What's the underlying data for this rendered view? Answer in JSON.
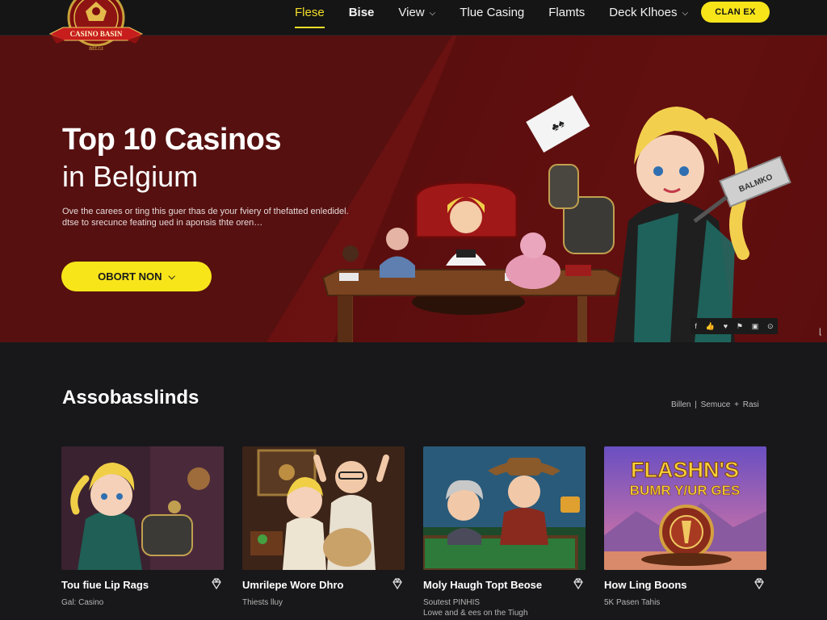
{
  "brand": {
    "logo_text": "CASINO BASIN",
    "logo_sub": "BELGI"
  },
  "nav": {
    "items": [
      {
        "label": "Flese",
        "active": true
      },
      {
        "label": "Bise",
        "bold": true
      },
      {
        "label": "View",
        "dropdown": true
      },
      {
        "label": "Tlue Casing"
      },
      {
        "label": "Flamts"
      },
      {
        "label": "Deck Klhoes",
        "dropdown": true
      }
    ],
    "cta": "CLAN EX"
  },
  "hero": {
    "title": "Top 10 Casinos",
    "subtitle": "in Belgium",
    "description_line1": "Ove the carees or ting this guer thas de your fviery of thefatted enledidel.",
    "description_line2": "dtse to srecunce feating ued in aponsis thte oren…",
    "button": "OBORT NON",
    "banner_sign": "BALMKO"
  },
  "section": {
    "title": "Assobasslinds",
    "link_left": "Billen",
    "separator": "|",
    "link_right": "Semuce + Rasi"
  },
  "cards": [
    {
      "title": "Tou fiue Lip Rags",
      "subtitle": "Gal: Casino",
      "subtitle2": ""
    },
    {
      "title": "Umrilepe Wore Dhro",
      "subtitle": "Thiests lluy",
      "subtitle2": ""
    },
    {
      "title": "Moly Haugh Topt Beose",
      "subtitle": "Soutest PINHIS",
      "subtitle2": "Lowe and & ees on the Tiugh"
    },
    {
      "title": "How Ling Boons",
      "subtitle": "5K Pasen Tahis",
      "subtitle2": ""
    }
  ],
  "card4_banner": {
    "line1": "FLASHN'S",
    "line2": "BUMR Y/UR GES"
  },
  "colors": {
    "accent": "#f7e51a",
    "hero_red": "#6b1010",
    "background": "#18181a"
  }
}
